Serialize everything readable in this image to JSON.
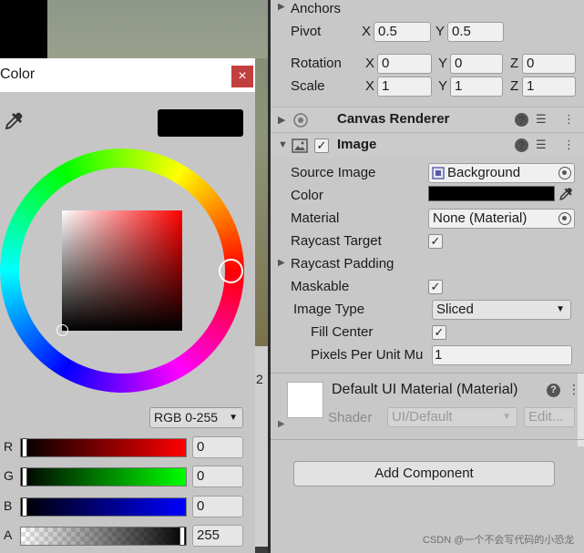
{
  "colors": {
    "accent_close": "#c1403f",
    "selected_color": "#000000",
    "hue_red": "#ff0000"
  },
  "color_picker": {
    "title": "Color",
    "close_glyph": "×",
    "mode_select": "RGB 0-255",
    "channels": [
      {
        "label": "R",
        "value": "0"
      },
      {
        "label": "G",
        "value": "0"
      },
      {
        "label": "B",
        "value": "0"
      },
      {
        "label": "A",
        "value": "255"
      }
    ]
  },
  "background_digit": "2",
  "inspector": {
    "anchors_label": "Anchors",
    "pivot": {
      "label": "Pivot",
      "x_axis": "X",
      "x": "0.5",
      "y_axis": "Y",
      "y": "0.5"
    },
    "rotation": {
      "label": "Rotation",
      "x_axis": "X",
      "x": "0",
      "y_axis": "Y",
      "y": "0",
      "z_axis": "Z",
      "z": "0"
    },
    "scale": {
      "label": "Scale",
      "x_axis": "X",
      "x": "1",
      "y_axis": "Y",
      "y": "1",
      "z_axis": "Z",
      "z": "1"
    },
    "canvas_renderer": {
      "name": "Canvas Renderer"
    },
    "image": {
      "name": "Image",
      "enabled": true,
      "source_image": {
        "label": "Source Image",
        "value": "Background"
      },
      "color": {
        "label": "Color",
        "value": "#000000"
      },
      "material": {
        "label": "Material",
        "value": "None (Material)"
      },
      "raycast_target": {
        "label": "Raycast Target",
        "checked": true
      },
      "raycast_padding": {
        "label": "Raycast Padding"
      },
      "maskable": {
        "label": "Maskable",
        "checked": true
      },
      "image_type": {
        "label": "Image Type",
        "value": "Sliced"
      },
      "fill_center": {
        "label": "Fill Center",
        "checked": true
      },
      "pixels_per_unit": {
        "label": "Pixels Per Unit Mu",
        "value": "1"
      }
    },
    "material_preview": {
      "name": "Default UI Material (Material)",
      "shader_label": "Shader",
      "shader_value": "UI/Default",
      "edit_button": "Edit..."
    },
    "add_component_button": "Add Component"
  },
  "watermark": "CSDN @一个不会写代码的小恐龙"
}
